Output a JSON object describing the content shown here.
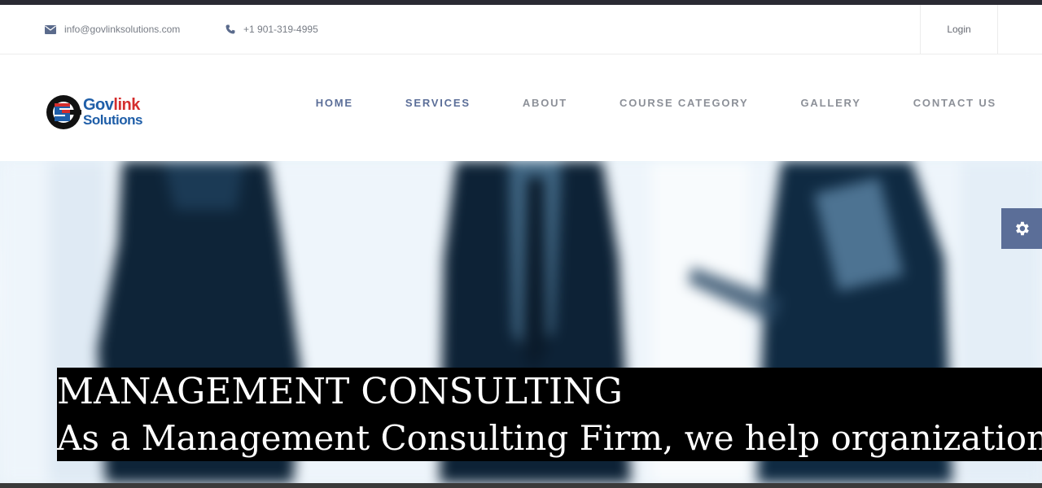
{
  "topbar": {
    "email": "info@govlinksolutions.com",
    "phone": "+1 901-319-4995",
    "login_label": "Login"
  },
  "logo": {
    "line1_a": "Gov",
    "line1_b": "link",
    "line2": "Solutions"
  },
  "nav": {
    "items": [
      {
        "label": "HOME"
      },
      {
        "label": "SERVICES"
      },
      {
        "label": "ABOUT"
      },
      {
        "label": "COURSE CATEGORY"
      },
      {
        "label": "GALLERY"
      },
      {
        "label": "CONTACT US"
      }
    ]
  },
  "hero": {
    "title": "MANAGEMENT CONSULTING",
    "subtitle": "As a Management Consulting Firm, we help organizations"
  },
  "icons": {
    "email": "envelope-icon",
    "phone": "phone-icon",
    "settings": "gear-icon"
  },
  "colors": {
    "accent": "#5b6e98",
    "nav_text": "#8c9098",
    "logo_blue": "#1f5ea8",
    "logo_red": "#d42d2d",
    "caption_bg": "#000000"
  }
}
